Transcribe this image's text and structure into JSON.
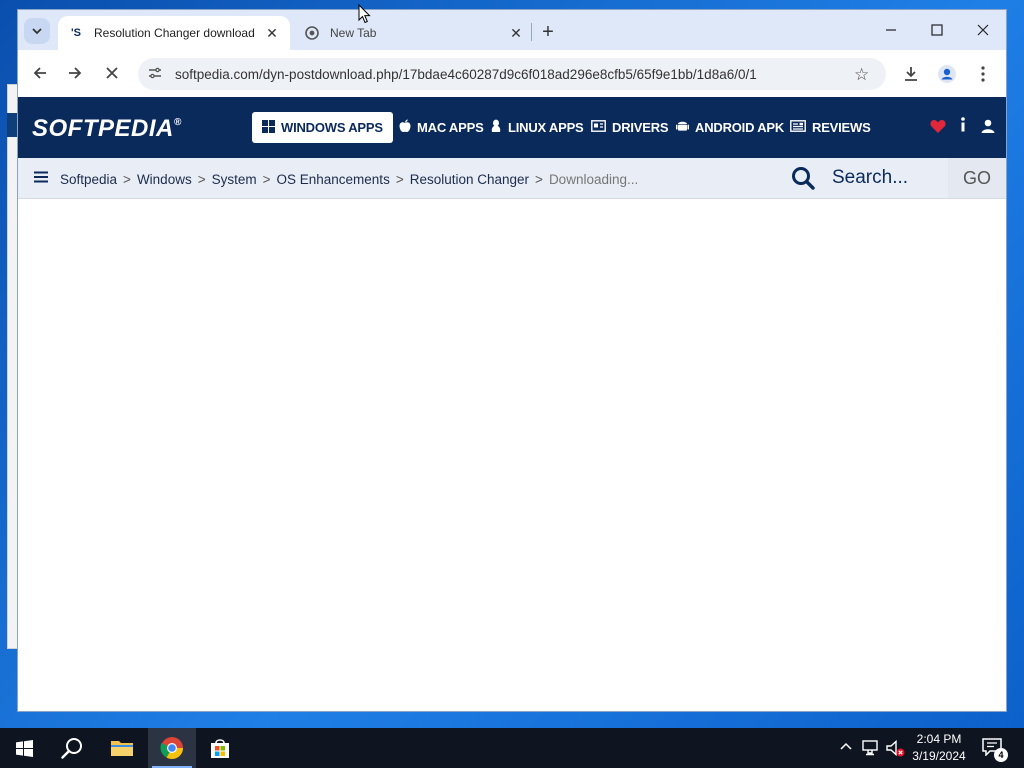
{
  "browser": {
    "tabs": [
      {
        "title": "Resolution Changer download",
        "favicon": "softpedia-s-icon",
        "favicon_text": "'S",
        "active": true
      },
      {
        "title": "New Tab",
        "favicon": "chrome-icon",
        "active": false
      }
    ],
    "address": "softpedia.com/dyn-postdownload.php/17bdae4c60287d9c6f018ad296e8cfb5/65f9e1bb/1d8a6/0/1"
  },
  "softpedia": {
    "logo": "SOFTPEDIA",
    "logo_mark": "®",
    "nav": [
      {
        "label": "WINDOWS APPS",
        "icon": "windows-icon",
        "active": true
      },
      {
        "label": "MAC APPS",
        "icon": "apple-icon",
        "active": false
      },
      {
        "label": "LINUX APPS",
        "icon": "linux-icon",
        "active": false
      },
      {
        "label": "DRIVERS",
        "icon": "drivers-icon",
        "active": false
      },
      {
        "label": "ANDROID APK",
        "icon": "android-icon",
        "active": false
      },
      {
        "label": "REVIEWS",
        "icon": "reviews-icon",
        "active": false
      }
    ],
    "breadcrumb": [
      "Softpedia",
      "Windows",
      "System",
      "OS Enhancements",
      "Resolution Changer",
      "Downloading..."
    ],
    "search_placeholder": "Search...",
    "go_label": "GO",
    "colors": {
      "navy": "#0b2a5c",
      "heart": "#e0283a"
    }
  },
  "taskbar": {
    "time": "2:04 PM",
    "date": "3/19/2024",
    "notification_count": "4"
  }
}
